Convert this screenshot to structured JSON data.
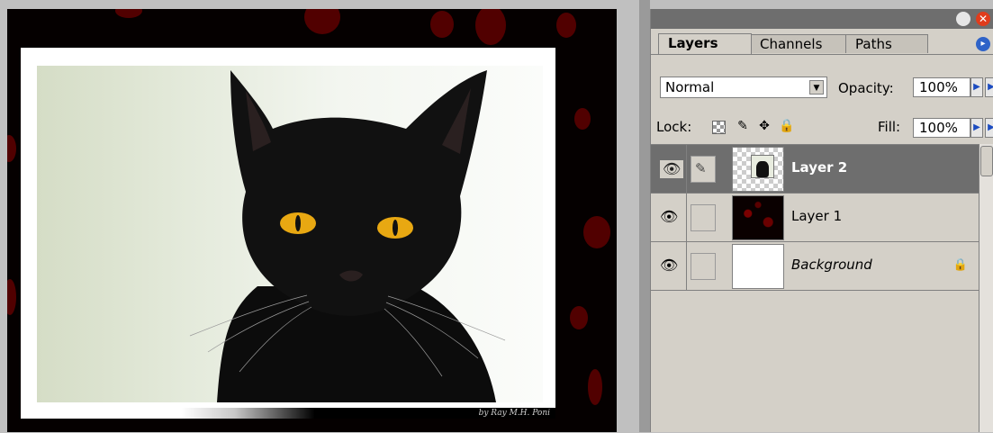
{
  "document": {
    "signature": "by Ray M.H. Poni"
  },
  "palette": {
    "tabs": [
      {
        "label": "Layers",
        "active": true
      },
      {
        "label": "Channels",
        "active": false
      },
      {
        "label": "Paths",
        "active": false
      }
    ],
    "blend_mode": "Normal",
    "opacity_label": "Opacity:",
    "opacity_value": "100%",
    "lock_label": "Lock:",
    "fill_label": "Fill:",
    "fill_value": "100%",
    "layers": [
      {
        "name": "Layer 2",
        "selected": true,
        "visible": true,
        "thumbnail": "cat-on-transparent"
      },
      {
        "name": "Layer 1",
        "selected": false,
        "visible": true,
        "thumbnail": "red-splatter"
      },
      {
        "name": "Background",
        "selected": false,
        "visible": true,
        "locked": true,
        "thumbnail": "white"
      }
    ]
  },
  "icons": {
    "eye": "eye-icon",
    "brush": "brush-icon",
    "move": "move-icon",
    "lock": "lock-icon",
    "close": "close-icon",
    "collapse": "collapse-icon",
    "menu": "palette-menu-icon",
    "dropdown": "chevron-down-icon"
  },
  "colors": {
    "selected_row": "#6e6e6e",
    "panel_bg": "#d4d0c8",
    "canvas_bg": "#050000",
    "splatter": "#5a0000",
    "close_button": "#e03c1c"
  }
}
